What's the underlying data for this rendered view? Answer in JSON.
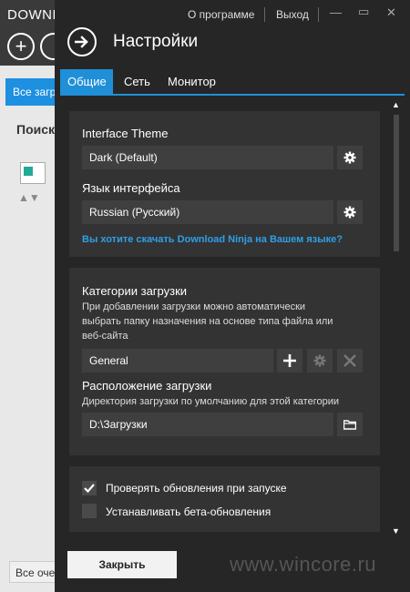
{
  "background_app": {
    "title": "DOWNL",
    "tab_label": "Все загр",
    "search_label": "Поиск",
    "bottom_label": "Все оче"
  },
  "topbar": {
    "about": "О программе",
    "exit": "Выход"
  },
  "panel": {
    "title": "Настройки"
  },
  "tabs": [
    {
      "label": "Общие",
      "active": true
    },
    {
      "label": "Сеть",
      "active": false
    },
    {
      "label": "Монитор",
      "active": false
    }
  ],
  "appearance": {
    "theme_label": "Interface Theme",
    "theme_value": "Dark (Default)",
    "language_label": "Язык интерфейса",
    "language_value": "Russian (Русский)",
    "language_link": "Вы хотите скачать Download Ninja на Вашем языке?"
  },
  "categories": {
    "label": "Категории загрузки",
    "description": "При добавлении загрузки можно автоматически выбрать папку назначения на основе типа файла или веб-сайта",
    "selected": "General",
    "location_label": "Расположение загрузки",
    "location_description": "Директория загрузки по умолчанию для этой категории",
    "location_value": "D:\\Загрузки"
  },
  "updates": {
    "check_on_start": {
      "label": "Проверять обновления при запуске",
      "checked": true
    },
    "beta_updates": {
      "label": "Устанавливать бета-обновления",
      "checked": false
    }
  },
  "footer": {
    "close_label": "Закрыть",
    "watermark": "www.wincore.ru"
  },
  "colors": {
    "accent": "#1f8fd8",
    "link": "#2f9fe8",
    "panel_bg": "#262626",
    "section_bg": "#333333"
  }
}
